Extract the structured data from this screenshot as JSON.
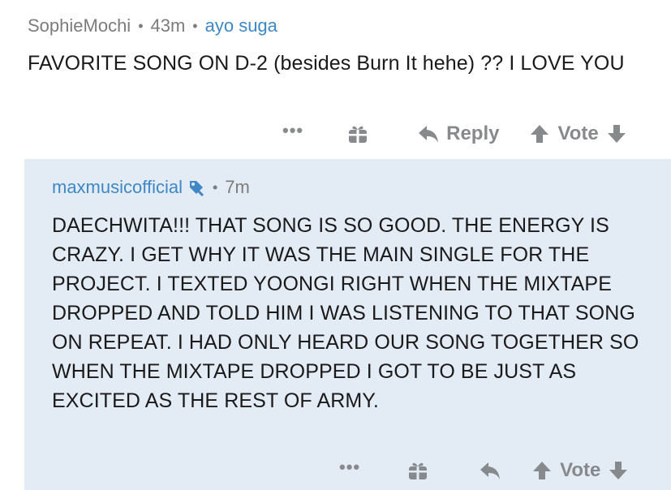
{
  "top_comment": {
    "username": "SophieMochi",
    "time": "43m",
    "flair": "ayo suga",
    "body": "FAVORITE SONG ON D-2 (besides Burn It hehe) ?? I LOVE YOU",
    "actions": {
      "more": "•••",
      "reply": "Reply",
      "vote": "Vote"
    }
  },
  "reply_comment": {
    "username": "maxmusicofficial",
    "time": "7m",
    "body": "DAECHWITA!!! THAT SONG IS SO GOOD. THE ENERGY IS CRAZY. I GET WHY IT WAS THE MAIN SINGLE FOR THE PROJECT. I TEXTED YOONGI RIGHT WHEN THE MIXTAPE DROPPED AND TOLD HIM I WAS LISTENING TO THAT SONG ON REPEAT. I HAD ONLY HEARD OUR SONG TOGETHER SO WHEN THE MIXTAPE DROPPED I GOT TO BE JUST AS EXCITED AS THE REST OF ARMY.",
    "actions": {
      "more": "•••",
      "vote": "Vote"
    }
  },
  "colors": {
    "link_blue": "#3f88c5",
    "meta_gray": "#7c7c7c",
    "reply_bg": "#e3ebf5"
  },
  "icons": [
    "gift-icon",
    "reply-arrow-icon",
    "upvote-arrow-icon",
    "downvote-arrow-icon",
    "mod-sword-icon"
  ]
}
